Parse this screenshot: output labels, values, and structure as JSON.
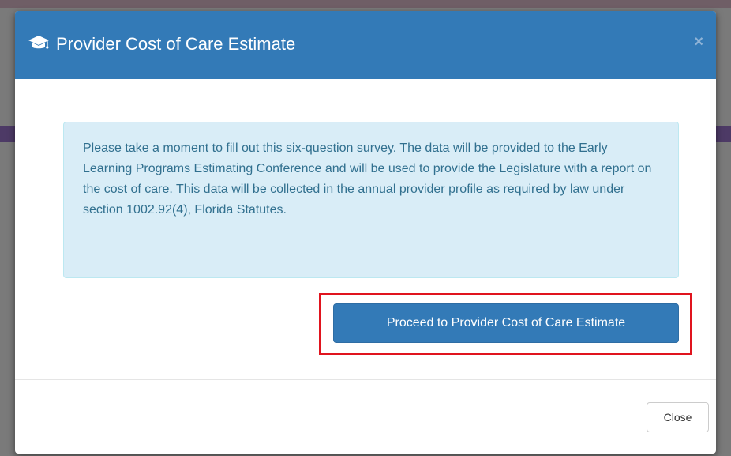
{
  "modal": {
    "title": "Provider Cost of Care Estimate",
    "header_icon": "graduation-cap-icon",
    "close_symbol": "×",
    "message": "Please take a moment to fill out this six-question survey. The data will be provided to the Early Learning Programs Estimating Conference and will be used to provide the Legislature with a report on the cost of care. This data will be collected in the annual provider profile as required by law under section 1002.92(4), Florida Statutes.",
    "proceed_label": "Proceed to Provider Cost of Care Estimate",
    "close_label": "Close"
  },
  "colors": {
    "header_bg": "#337ab7",
    "alert_bg": "#d9edf7",
    "alert_text": "#31708f",
    "highlight_border": "#e0141e"
  }
}
